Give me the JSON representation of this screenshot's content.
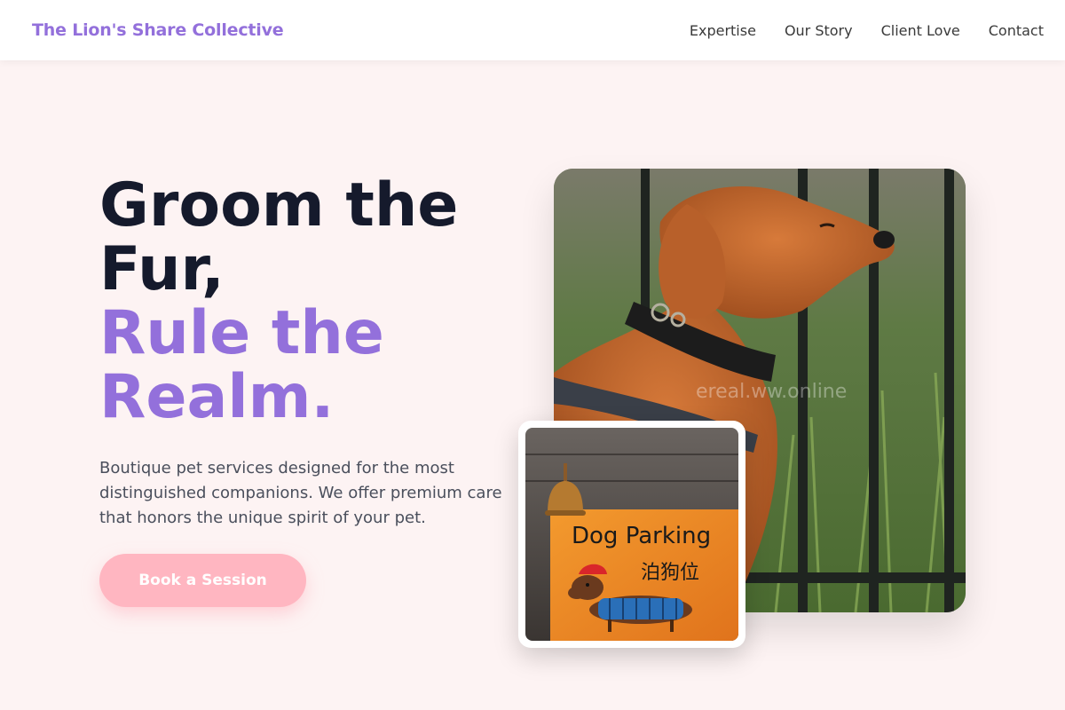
{
  "header": {
    "brand": "The Lion's Share Collective",
    "nav": [
      "Expertise",
      "Our Story",
      "Client Love",
      "Contact"
    ]
  },
  "hero": {
    "headline_line1": "Groom the",
    "headline_line2": "Fur,",
    "headline_accent_line1": "Rule the",
    "headline_accent_line2": "Realm.",
    "tagline": "Boutique pet services designed for the most distinguished companions. We offer premium care that honors the unique spirit of your pet.",
    "cta_label": "Book a Session"
  },
  "images": {
    "main": {
      "subject": "dog-photo",
      "watermark": "ereal.ww.online"
    },
    "inset": {
      "subject": "dog-parking-sign-photo",
      "sign_text_en": "Dog Parking",
      "sign_text_zh": "泊狗位"
    }
  },
  "colors": {
    "accent": "#9370db",
    "cta": "#ffb6c1",
    "background": "#fdf3f3",
    "headline": "#151a2c"
  }
}
